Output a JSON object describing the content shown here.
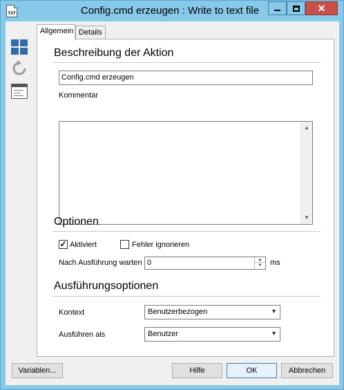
{
  "window": {
    "title": "Config.cmd erzeugen : Write to text file",
    "icon_label": "TXT",
    "controls": {
      "minimize": "minimize-icon",
      "maximize": "maximize-icon",
      "close": "✕"
    }
  },
  "toolbar": {
    "icons": [
      "grid-view-icon",
      "refresh-icon",
      "form-view-icon"
    ]
  },
  "tabs": [
    {
      "label": "Allgemein",
      "active": true
    },
    {
      "label": "Details",
      "active": false
    }
  ],
  "beschreibung": {
    "heading": "Beschreibung der Aktion",
    "name_value": "Config.cmd erzeugen",
    "comment_label": "Kommentar",
    "comment_value": ""
  },
  "optionen": {
    "heading": "Optionen",
    "aktiviert_label": "Aktiviert",
    "aktiviert_checked": true,
    "fehler_label": "Fehler ignorieren",
    "fehler_checked": false,
    "wait_label": "Nach Ausführung warten",
    "wait_value": "0",
    "wait_unit": "ms"
  },
  "ausfuehrung": {
    "heading": "Ausführungsoptionen",
    "kontext_label": "Kontext",
    "kontext_value": "Benutzerbezogen",
    "ausfuehren_label": "Ausführen als",
    "ausfuehren_value": "Benutzer"
  },
  "footer": {
    "variables_label": "Variablen...",
    "help_label": "Hilfe",
    "ok_label": "OK",
    "cancel_label": "Abbrechen"
  },
  "colors": {
    "frame": "#87c9e8",
    "close": "#c7504b",
    "accent_icon": "#2f6bad"
  }
}
